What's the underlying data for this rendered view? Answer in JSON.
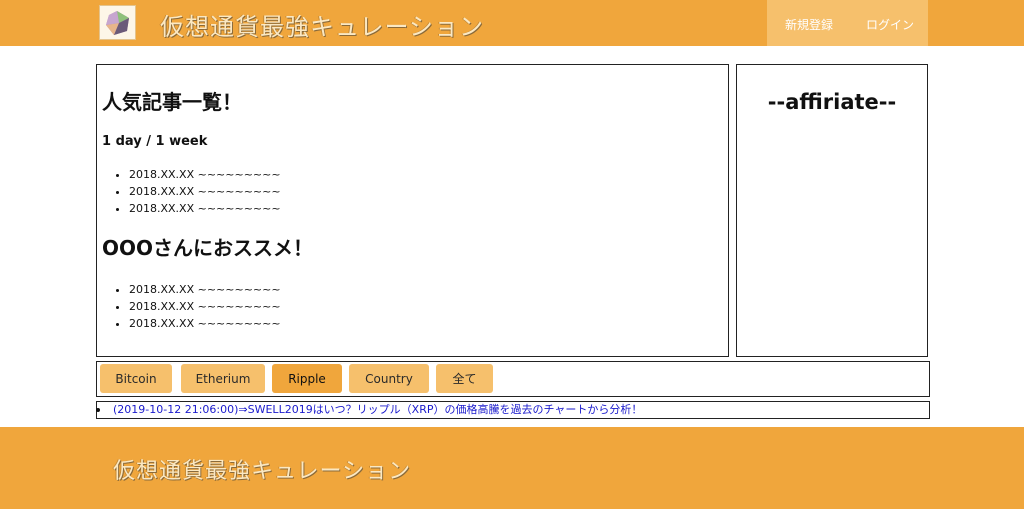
{
  "header": {
    "site_title": "仮想通貨最強キュレーション",
    "signup_label": "新規登録",
    "login_label": "ログイン"
  },
  "main": {
    "popular_title": "人気記事一覧！",
    "period_label": "1 day / 1 week",
    "popular_items": [
      "2018.XX.XX ~~~~~~~~~",
      "2018.XX.XX ~~~~~~~~~",
      "2018.XX.XX ~~~~~~~~~"
    ],
    "recommend_title": "OOOさんにおススメ！",
    "recommend_items": [
      "2018.XX.XX ~~~~~~~~~",
      "2018.XX.XX ~~~~~~~~~",
      "2018.XX.XX ~~~~~~~~~"
    ]
  },
  "sidebar": {
    "title": "--affiriate--"
  },
  "categories": {
    "buttons": [
      "Bitcoin",
      "Etherium",
      "Ripple",
      "Country",
      "全て"
    ],
    "active": "Ripple"
  },
  "news": {
    "item": "(2019-10-12 21:06:00)⇒SWELL2019はいつ？リップル（XRP）の価格高騰を過去のチャートから分析！"
  },
  "footer": {
    "site_title": "仮想通貨最強キュレーション"
  },
  "colors": {
    "brand_orange": "#f0a63c",
    "light_orange": "#f6c06c",
    "link_blue": "#1a1acc"
  }
}
